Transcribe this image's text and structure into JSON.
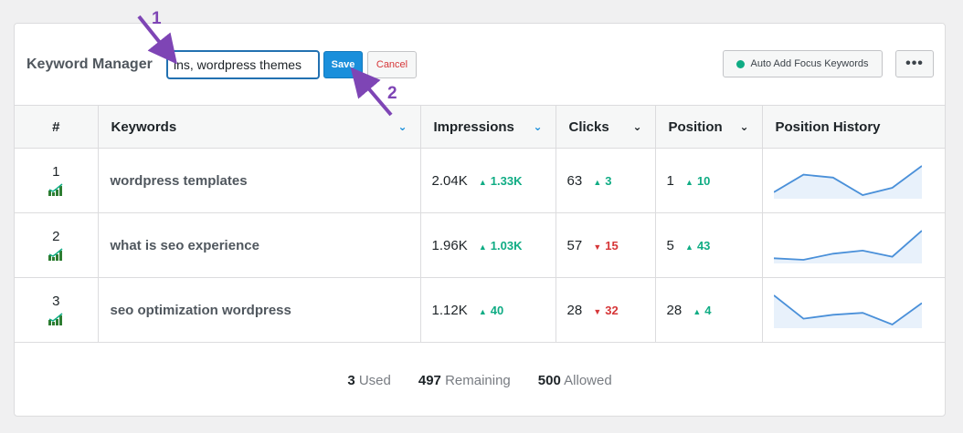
{
  "title": "Keyword Manager",
  "input_value": "ins, wordpress themes",
  "save_label": "Save",
  "cancel_label": "Cancel",
  "auto_add_label": "Auto Add Focus Keywords",
  "more_label": "•••",
  "columns": {
    "num": "#",
    "keywords": "Keywords",
    "impressions": "Impressions",
    "clicks": "Clicks",
    "position": "Position",
    "history": "Position History"
  },
  "rows": [
    {
      "rank": "1",
      "keyword": "wordpress templates",
      "impressions": "2.04K",
      "impressions_delta": "1.33K",
      "impressions_dir": "up",
      "clicks": "63",
      "clicks_delta": "3",
      "clicks_dir": "up",
      "position": "1",
      "position_delta": "10",
      "position_dir": "up",
      "history": [
        6,
        18,
        16,
        4,
        9,
        24
      ]
    },
    {
      "rank": "2",
      "keyword": "what is seo experience",
      "impressions": "1.96K",
      "impressions_delta": "1.03K",
      "impressions_dir": "up",
      "clicks": "57",
      "clicks_delta": "15",
      "clicks_dir": "down",
      "position": "5",
      "position_delta": "43",
      "position_dir": "up",
      "history": [
        6,
        5,
        9,
        11,
        7,
        24
      ]
    },
    {
      "rank": "3",
      "keyword": "seo optimization wordpress",
      "impressions": "1.12K",
      "impressions_delta": "40",
      "impressions_dir": "up",
      "clicks": "28",
      "clicks_delta": "32",
      "clicks_dir": "down",
      "position": "28",
      "position_delta": "4",
      "position_dir": "up",
      "history": [
        20,
        8,
        10,
        11,
        5,
        16
      ]
    }
  ],
  "footer": {
    "used_count": "3",
    "used_label": "Used",
    "remaining_count": "497",
    "remaining_label": "Remaining",
    "allowed_count": "500",
    "allowed_label": "Allowed"
  },
  "annotations": {
    "step1": "1",
    "step2": "2"
  },
  "colors": {
    "accent": "#1a8fdb",
    "up": "#10ac84",
    "down": "#d63638",
    "annotation": "#7e45b5"
  }
}
